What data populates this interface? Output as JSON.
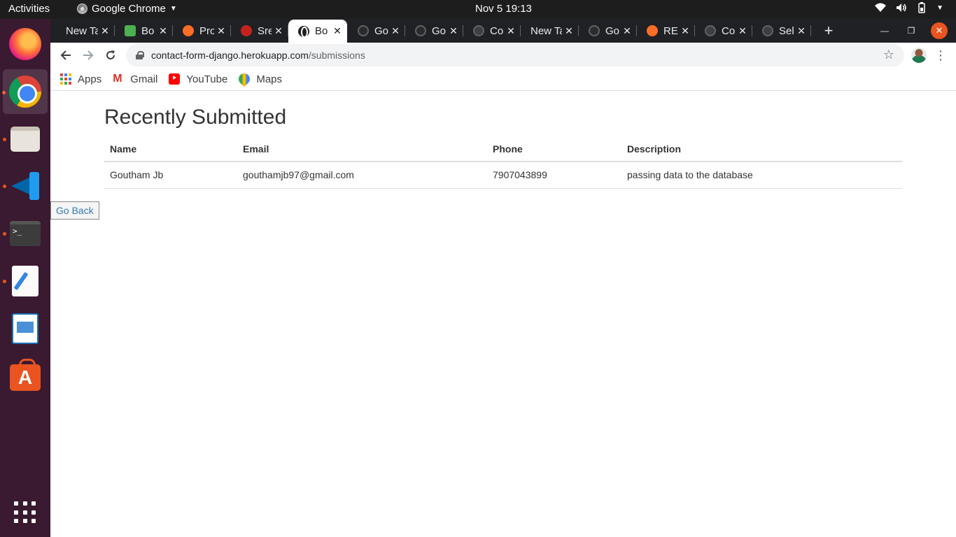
{
  "topbar": {
    "activities": "Activities",
    "app_name": "Google Chrome",
    "clock": "Nov 5  19:13"
  },
  "dock": {
    "items": [
      "firefox",
      "google-chrome",
      "files",
      "visual-studio-code",
      "terminal",
      "text-editor",
      "libreoffice-impress",
      "ubuntu-software",
      "show-applications"
    ]
  },
  "browser": {
    "tabs": [
      {
        "label": "New Tab",
        "favicon": "none",
        "active": false
      },
      {
        "label": "Bo",
        "favicon": "green-logo",
        "active": false
      },
      {
        "label": "Pro",
        "favicon": "gitlab-fox",
        "active": false
      },
      {
        "label": "Sre",
        "favicon": "gmail",
        "active": false
      },
      {
        "label": "Bo",
        "favicon": "globe",
        "active": true
      },
      {
        "label": "Go",
        "favicon": "github",
        "active": false
      },
      {
        "label": "Go",
        "favicon": "github",
        "active": false
      },
      {
        "label": "Co",
        "favicon": "loading-globe",
        "active": false
      },
      {
        "label": "New Tab",
        "favicon": "none",
        "active": false
      },
      {
        "label": "Go",
        "favicon": "github",
        "active": false
      },
      {
        "label": "RE",
        "favicon": "gitlab-fox",
        "active": false
      },
      {
        "label": "Co",
        "favicon": "loading-globe",
        "active": false
      },
      {
        "label": "Sel",
        "favicon": "loading-globe",
        "active": false
      }
    ],
    "url_host": "contact-form-django.herokuapp.com",
    "url_path": "/submissions",
    "bookmarks": [
      {
        "label": "Apps",
        "icon": "apps-grid"
      },
      {
        "label": "Gmail",
        "icon": "gmail"
      },
      {
        "label": "YouTube",
        "icon": "youtube"
      },
      {
        "label": "Maps",
        "icon": "google-maps"
      }
    ]
  },
  "page": {
    "title": "Recently Submitted",
    "table": {
      "headers": [
        "Name",
        "Email",
        "Phone",
        "Description"
      ],
      "rows": [
        [
          "Goutham Jb",
          "gouthamjb97@gmail.com",
          "7907043899",
          "passing data to the database"
        ]
      ]
    },
    "go_back_label": "Go Back"
  },
  "colors": {
    "ubuntu_orange": "#e95420",
    "tab_strip": "#202124",
    "link_blue": "#337ab7"
  }
}
